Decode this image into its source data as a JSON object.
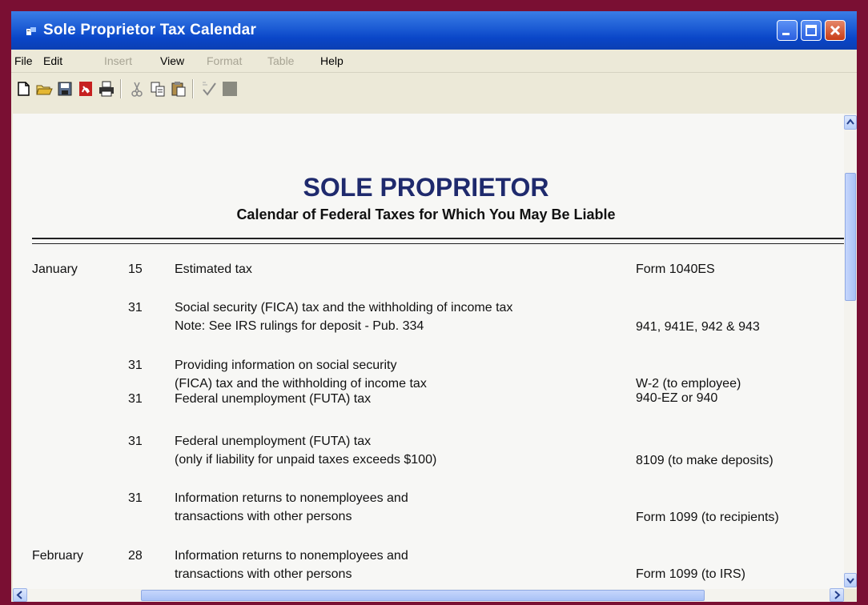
{
  "window": {
    "title": "Sole Proprietor Tax Calendar",
    "controls": [
      "minimize-icon",
      "maximize-icon",
      "close-icon"
    ]
  },
  "menu": {
    "items": [
      {
        "label": "File",
        "enabled": true
      },
      {
        "label": "Edit",
        "enabled": true
      },
      {
        "label": "Insert",
        "enabled": false
      },
      {
        "label": "View",
        "enabled": true
      },
      {
        "label": "Format",
        "enabled": false
      },
      {
        "label": "Table",
        "enabled": false
      },
      {
        "label": "Help",
        "enabled": true
      }
    ]
  },
  "toolbar": {
    "buttons": [
      "new-document-icon",
      "open-folder-icon",
      "save-icon",
      "pdf-icon",
      "print-icon",
      "cut-icon",
      "copy-icon",
      "paste-icon",
      "spellcheck-icon",
      "color-swatch-icon"
    ]
  },
  "document": {
    "title": "SOLE PROPRIETOR",
    "subtitle": "Calendar of Federal Taxes for Which You May Be Liable",
    "rows": [
      {
        "month": "January",
        "day": "15",
        "desc1": "Estimated tax",
        "desc2": "",
        "form": "Form 1040ES"
      },
      {
        "month": "",
        "day": "31",
        "desc1": "Social security (FICA) tax and the withholding of income tax",
        "desc2": "Note: See IRS rulings for deposit - Pub. 334",
        "form": "941, 941E, 942 & 943"
      },
      {
        "month": "",
        "day": "31",
        "desc1": "Providing information on social security",
        "desc2": "(FICA) tax and the withholding of income tax",
        "form": "W-2 (to employee)"
      },
      {
        "month": "",
        "day": "31",
        "desc1": "Federal unemployment (FUTA) tax",
        "desc2": "",
        "form": "940-EZ or 940"
      },
      {
        "month": "",
        "day": "31",
        "desc1": "Federal unemployment (FUTA) tax",
        "desc2": "(only if liability for unpaid taxes exceeds $100)",
        "form": "8109 (to make deposits)"
      },
      {
        "month": "",
        "day": "31",
        "desc1": "Information returns to nonemployees and",
        "desc2": "transactions with other persons",
        "form": "Form 1099 (to recipients)"
      },
      {
        "month": "February",
        "day": "28",
        "desc1": "Information returns to nonemployees and",
        "desc2": "transactions with other persons",
        "form": "Form 1099 (to IRS)"
      }
    ]
  },
  "scrollbars": {
    "vertical": [
      "scroll-up-icon",
      "scroll-down-icon"
    ],
    "horizontal": [
      "scroll-left-icon",
      "scroll-right-icon"
    ]
  },
  "colors": {
    "desktop_bg": "#7a0f33",
    "titlebar": "#0a46c8",
    "doc_title": "#1f2a6d"
  }
}
